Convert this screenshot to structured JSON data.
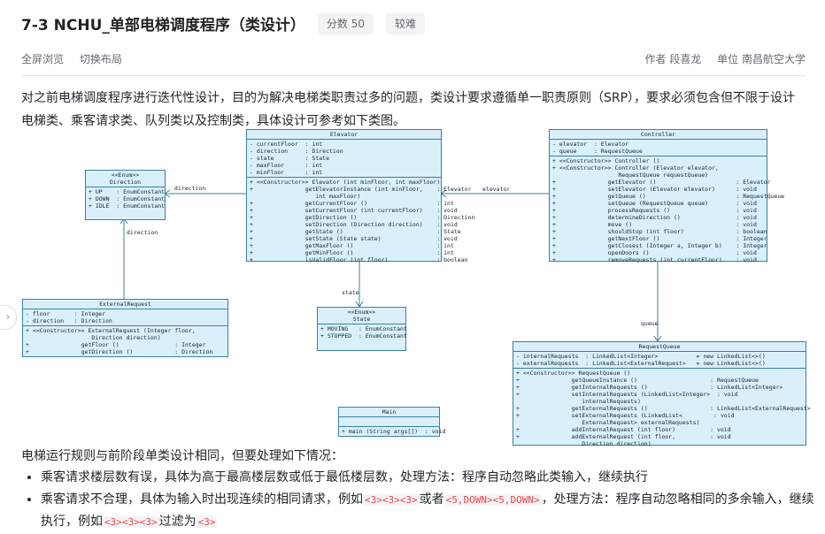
{
  "header": {
    "title": "7-3 NCHU_单部电梯调度程序（类设计）",
    "score_badge": "分数 50",
    "difficulty_badge": "较难"
  },
  "toolbar": {
    "fullscreen": "全屏浏览",
    "layout": "切换布局",
    "author": "作者 段喜龙",
    "unit": "单位 南昌航空大学"
  },
  "intro": "对之前电梯调度程序进行迭代性设计，目的为解决电梯类职责过多的问题，类设计要求遵循单一职责原则（SRP），要求必须包含但不限于设计电梯类、乘客请求类、队列类以及控制类，具体设计可参考如下类图。",
  "side_tab_icon": "chevron-right-icon",
  "diagram": {
    "direction": {
      "header": [
        "<<Enum>>",
        "Direction"
      ],
      "fields": [
        "+ UP    : EnumConstant",
        "+ DOWN  : EnumConstant",
        "+ IDLE  : EnumConstant"
      ]
    },
    "elevator": {
      "header": [
        "Elevator"
      ],
      "fields": [
        "- currentFloor  : int",
        "- direction     : Direction",
        "- state         : State",
        "- maxFloor      : int",
        "- minFloor      : int"
      ],
      "methods": [
        "+ <<Constructor>> Elevator (int minFloor, int maxFloor)",
        "+               getElevatorInstance (int minFloor,    : Elevator",
        "                   int maxFloor)",
        "+               getCurrentFloor ()                    : int",
        "+               setCurrentFloor (int currentFloor)    : void",
        "+               getDirection ()                       : Direction",
        "+               setDirection (Direction direction)    : void",
        "+               getState ()                           : State",
        "+               setState (State state)                : void",
        "+               getMaxFloor ()                        : int",
        "+               getMinFloor ()                        : int",
        "+               isValidFloor (int floor)              : boolean"
      ]
    },
    "controller": {
      "header": [
        "Controller"
      ],
      "fields": [
        "- elevator  : Elevator",
        "- queue     : RequestQueue"
      ],
      "methods": [
        "+ <<Constructor>> Controller ()",
        "+ <<Constructor>> Controller (Elevator elevator,",
        "                   RequestQueue requestQueue)",
        "+               getElevator ()                       : Elevator",
        "+               setElevator (Elevator elevator)      : void",
        "+               getQueue ()                          : RequestQueue",
        "+               setQueue (RequestQueue queue)        : void",
        "+               processRequests ()                   : void",
        "+               determineDirection ()                : void",
        "+               move ()                              : void",
        "+               shouldStop (int floor)               : boolean",
        "+               getNextFloor ()                      : Integer",
        "+               getClosest (Integer a, Integer b)    : Integer",
        "+               openDoors ()                         : void",
        "+               removeRequests (int currentFloor)    : void"
      ]
    },
    "external": {
      "header": [
        "ExternalRequest"
      ],
      "fields": [
        "- floor       : Integer",
        "- direction   : Direction"
      ],
      "methods": [
        "+ <<Constructor>> ExternalRequest (Integer floor,",
        "                   Direction direction)",
        "+               getFloor ()                : Integer",
        "+               getDirection ()            : Direction"
      ]
    },
    "state": {
      "header": [
        "<<Enum>>",
        "State"
      ],
      "fields": [
        "+ MOVING   : EnumConstant",
        "+ STOPPED  : EnumConstant"
      ]
    },
    "main": {
      "header": [
        "Main"
      ],
      "fields": [
        " "
      ],
      "methods": [
        "+ main (String args[])  : void"
      ]
    },
    "queue": {
      "header": [
        "RequestQueue"
      ],
      "fields": [
        "- internalRequests  : LinkedList<Integer>           = new LinkedList<>()",
        "- externalRequests  : LinkedList<ExternalRequest>   = new LinkedList<>()"
      ],
      "methods": [
        "+ <<Constructor>> RequestQueue ()",
        "+               getQueueInstance ()                     : RequestQueue",
        "+               getInternalRequests ()                  : LinkedList<Integer>",
        "+               setInternalRequests (LinkedList<Integer>  : void",
        "                   internalRequests)",
        "+               getExternalRequests ()                  : LinkedList<ExternalRequest>",
        "+               setExternalRequests (LinkedList<         : void",
        "                   ExternalRequest> externalRequests)",
        "+               addInternalRequest (int floor)          : void",
        "+               addExternalRequest (int floor,          : void",
        "                   Direction direction)"
      ]
    },
    "labels": {
      "direction_assoc": "direction",
      "direction_vertical": "direction",
      "elevator_assoc": "elevator",
      "state_assoc": "state",
      "queue_assoc": "queue"
    }
  },
  "rules": {
    "intro": "电梯运行规则与前阶段单类设计相同，但要处理如下情况：",
    "item1": "乘客请求楼层数有误，具体为高于最高楼层数或低于最低楼层数，处理方法：程序自动忽略此类输入，继续执行",
    "item2_a": "乘客请求不合理，具体为输入时出现连续的相同请求，例如",
    "item2_code1": "<3><3><3>",
    "item2_b": "或者",
    "item2_code2": "<5,DOWN><5,DOWN>",
    "item2_c": "，处理方法：程序自动忽略相同的多余输入，继续执行，例如",
    "item2_code3": "<3><3><3>",
    "item2_d": "过滤为",
    "item2_code4": "<3>"
  }
}
